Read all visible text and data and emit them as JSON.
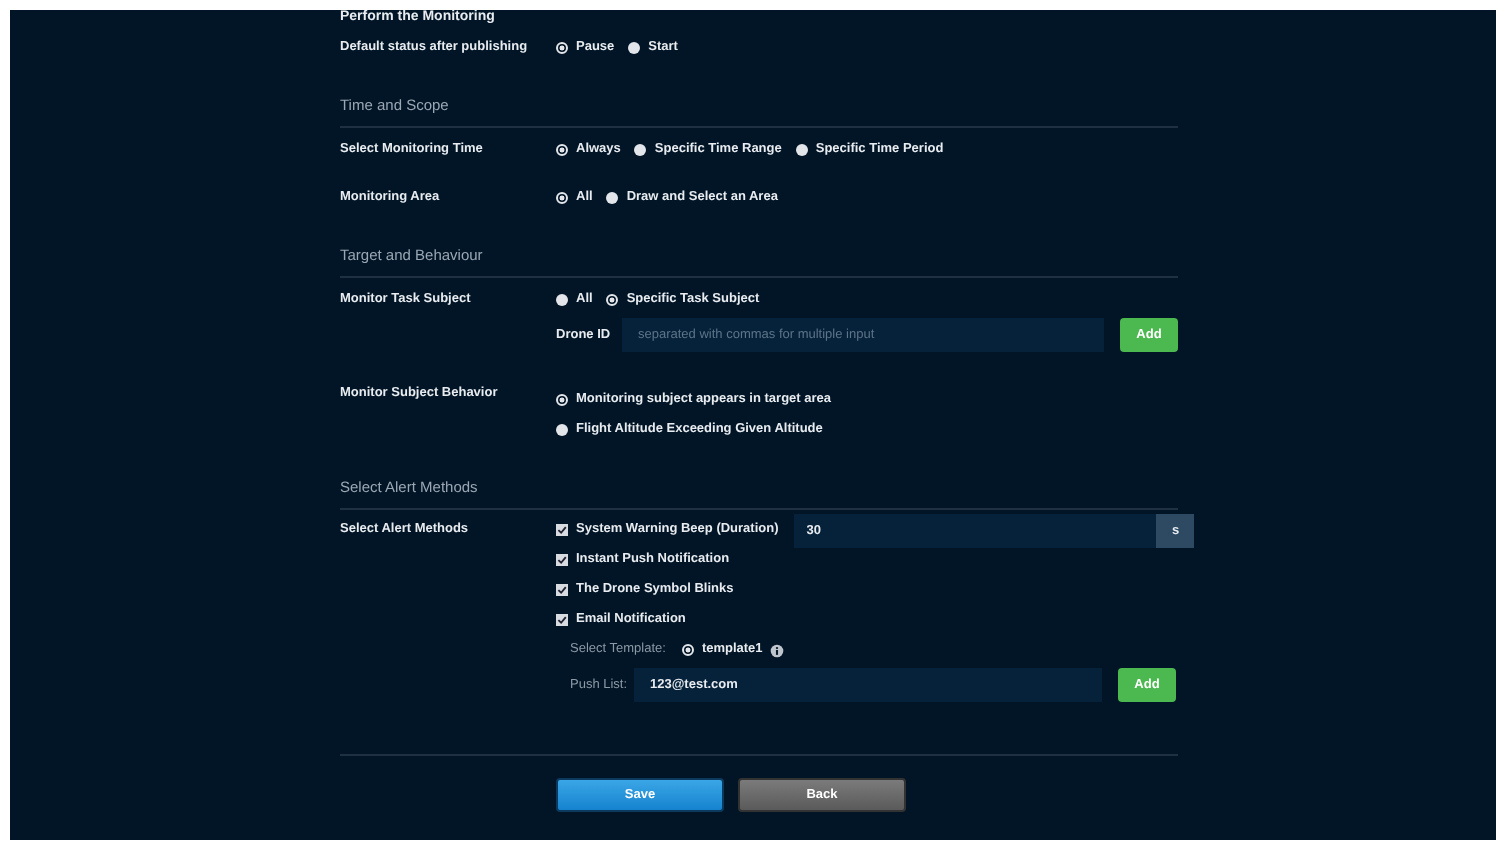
{
  "cut_heading": "Perform the Monitoring",
  "sections": [
    {
      "rows": [
        {
          "kind": "radio",
          "label": "Default status after publishing",
          "options": [
            {
              "label": "Pause",
              "selected": true
            },
            {
              "label": "Start",
              "selected": false
            }
          ]
        }
      ]
    },
    {
      "title": "Time and Scope",
      "rows": [
        {
          "kind": "radio",
          "label": "Select Monitoring Time",
          "options": [
            {
              "label": "Always",
              "selected": true
            },
            {
              "label": "Specific Time Range",
              "selected": false
            },
            {
              "label": "Specific Time Period",
              "selected": false
            }
          ]
        },
        {
          "kind": "radio",
          "label": "Monitoring Area",
          "options": [
            {
              "label": "All",
              "selected": true
            },
            {
              "label": "Draw and Select an Area",
              "selected": false
            }
          ]
        }
      ]
    },
    {
      "title": "Target and Behaviour",
      "rows": [
        {
          "kind": "radio",
          "label": "Monitor Task Subject",
          "options": [
            {
              "label": "All",
              "selected": false
            },
            {
              "label": "Specific Task Subject",
              "selected": true
            }
          ],
          "field": {
            "label": "Drone ID",
            "placeholder": "separated with commas for multiple input",
            "button": "Add"
          }
        },
        {
          "kind": "radio_stack",
          "label": "Monitor Subject Behavior",
          "options": [
            {
              "label": "Monitoring subject appears in target area",
              "selected": true
            },
            {
              "label": "Flight Altitude Exceeding Given Altitude",
              "selected": false
            }
          ]
        }
      ]
    },
    {
      "title": "Select Alert Methods",
      "rows": [
        {
          "kind": "checks",
          "label": "Select Alert Methods",
          "checks": [
            {
              "label": "System Warning Beep (Duration)",
              "checked": true,
              "value": "30",
              "unit": "s"
            },
            {
              "label": "Instant Push Notification",
              "checked": true
            },
            {
              "label": "The Drone Symbol Blinks",
              "checked": true
            },
            {
              "label": "Email Notification",
              "checked": true
            }
          ],
          "template": {
            "label": "Select Template:",
            "options": [
              {
                "label": "template1",
                "selected": true
              }
            ]
          },
          "push_list": {
            "label": "Push List:",
            "value": "123@test.com",
            "button": "Add"
          }
        }
      ]
    }
  ],
  "buttons": [
    {
      "label": "Save",
      "kind": "primary"
    },
    {
      "label": "Back",
      "kind": "secondary"
    }
  ]
}
